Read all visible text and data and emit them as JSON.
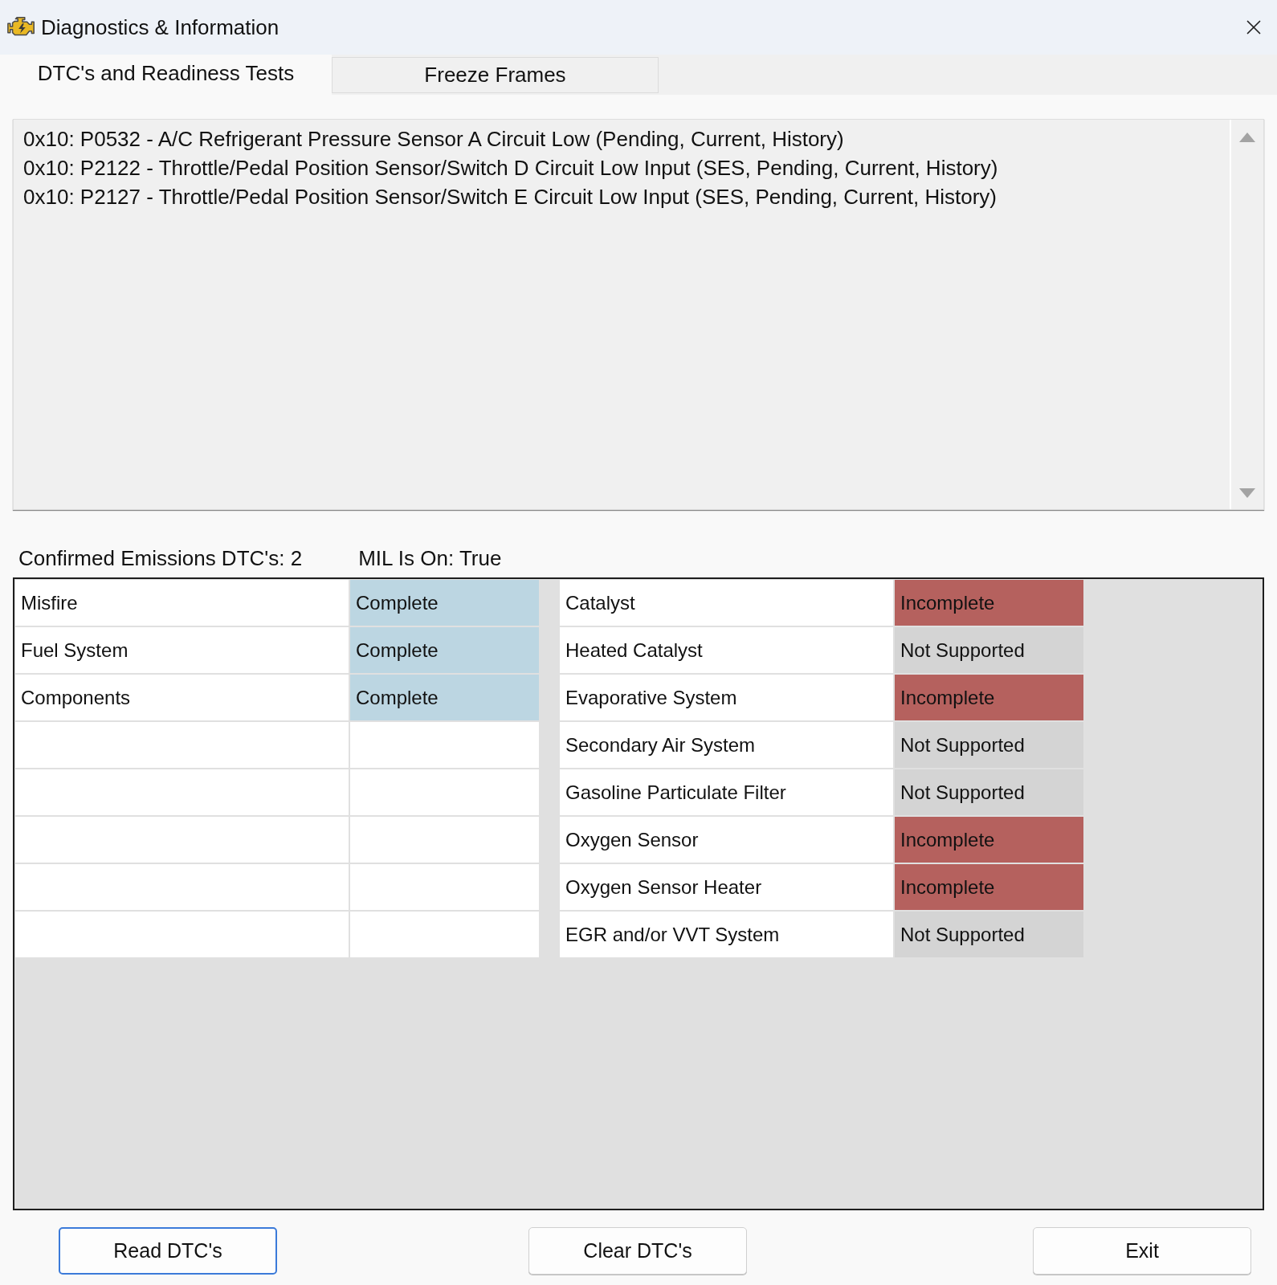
{
  "window": {
    "title": "Diagnostics & Information"
  },
  "tabs": [
    {
      "label": "DTC's and Readiness Tests",
      "selected": true
    },
    {
      "label": "Freeze Frames",
      "selected": false
    }
  ],
  "dtc_list": {
    "items": [
      "0x10: P0532 - A/C Refrigerant Pressure Sensor A Circuit Low (Pending, Current, History)",
      "0x10: P2122 - Throttle/Pedal Position Sensor/Switch D Circuit Low Input (SES, Pending, Current, History)",
      "0x10: P2127 - Throttle/Pedal Position Sensor/Switch E Circuit Low Input (SES, Pending, Current, History)"
    ]
  },
  "summary": {
    "confirmed_emissions_dtcs": "Confirmed Emissions DTC's: 2",
    "mil_status": "MIL Is On: True"
  },
  "readiness": {
    "left": [
      {
        "name": "Misfire",
        "status": "Complete",
        "color": "#bcd6e2"
      },
      {
        "name": "Fuel System",
        "status": "Complete",
        "color": "#bcd6e2"
      },
      {
        "name": "Components",
        "status": "Complete",
        "color": "#bcd6e2"
      }
    ],
    "right": [
      {
        "name": "Catalyst",
        "status": "Incomplete",
        "color": "#b5615e"
      },
      {
        "name": "Heated Catalyst",
        "status": "Not Supported",
        "color": "#d4d4d4"
      },
      {
        "name": "Evaporative System",
        "status": "Incomplete",
        "color": "#b5615e"
      },
      {
        "name": "Secondary Air System",
        "status": "Not Supported",
        "color": "#d4d4d4"
      },
      {
        "name": "Gasoline Particulate Filter",
        "status": "Not Supported",
        "color": "#d4d4d4"
      },
      {
        "name": "Oxygen Sensor",
        "status": "Incomplete",
        "color": "#b5615e"
      },
      {
        "name": "Oxygen Sensor Heater",
        "status": "Incomplete",
        "color": "#b5615e"
      },
      {
        "name": "EGR and/or VVT System",
        "status": "Not Supported",
        "color": "#d4d4d4"
      }
    ]
  },
  "buttons": [
    {
      "label": "Read DTC's",
      "focused": true
    },
    {
      "label": "Clear DTC's",
      "focused": false
    },
    {
      "label": "Exit",
      "focused": false
    }
  ]
}
